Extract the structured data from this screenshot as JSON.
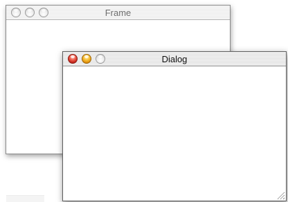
{
  "frame": {
    "title": "Frame",
    "controls": {
      "close": "close-button",
      "minimize": "minimize-button",
      "zoom": "zoom-button"
    }
  },
  "dialog": {
    "title": "Dialog",
    "controls": {
      "close": "close-button",
      "minimize": "minimize-button",
      "zoom": "zoom-button"
    },
    "resize_grip": "resize-grip-icon"
  },
  "colors": {
    "close_active": "#e0463a",
    "minimize_active": "#f2b22a",
    "inactive_button": "#e4e4e4",
    "window_background": "#ffffff"
  }
}
